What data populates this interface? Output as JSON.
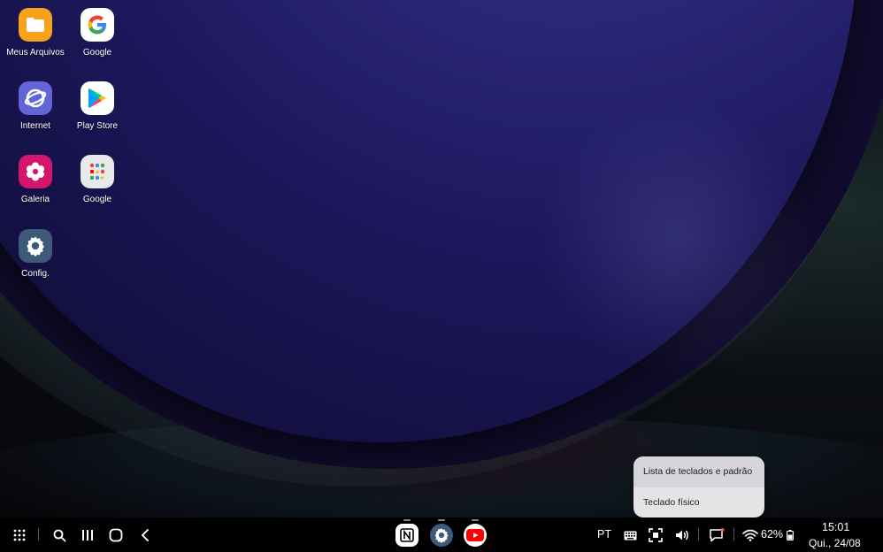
{
  "desktop": {
    "apps": [
      {
        "label": "Meus Arquivos",
        "icon": "folder-icon",
        "color": "#f6a31a"
      },
      {
        "label": "Google",
        "icon": "google-icon",
        "color": "#ffffff"
      },
      {
        "label": "Internet",
        "icon": "internet-icon",
        "color": "#6264d8"
      },
      {
        "label": "Play Store",
        "icon": "play-store-icon",
        "color": "#ffffff"
      },
      {
        "label": "Galeria",
        "icon": "gallery-icon",
        "color": "#d3166c"
      },
      {
        "label": "Google",
        "icon": "google-folder-icon",
        "color": "#e9e9ea"
      },
      {
        "label": "Config.",
        "icon": "settings-icon",
        "color": "#3d5a78"
      }
    ]
  },
  "keyboard_menu": {
    "items": [
      "Lista de teclados e padrão",
      "Teclado físico"
    ]
  },
  "taskbar": {
    "language": "PT",
    "battery": "62%",
    "time": "15:01",
    "date": "Qui., 24/08",
    "pinned_apps": [
      "notion-icon",
      "settings-icon",
      "youtube-icon"
    ]
  }
}
